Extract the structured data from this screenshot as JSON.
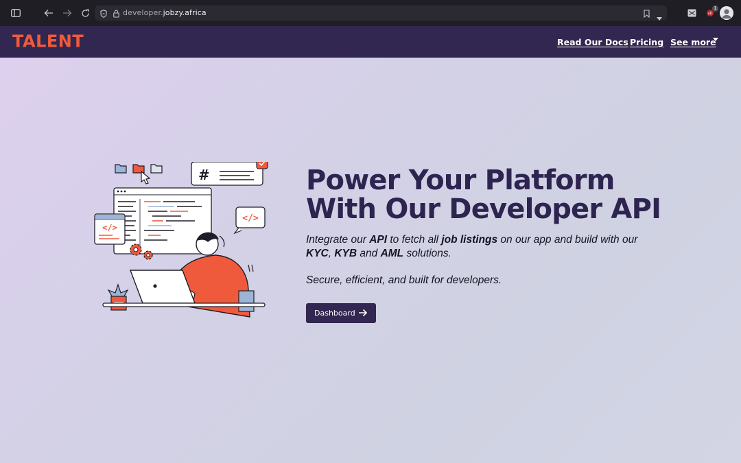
{
  "browser": {
    "url_domain_prefix": "developer.",
    "url_domain_main": "jobzy.africa",
    "badge_count": "1"
  },
  "nav": {
    "logo": "TALENT",
    "links": [
      "Read Our Docs",
      "Pricing",
      "See more"
    ]
  },
  "hero": {
    "title_line1": "Power Your Platform",
    "title_line2": "With Our Developer API",
    "desc_parts": [
      "Integrate our ",
      "API",
      " to fetch all ",
      "job listings",
      " on our app and build with our ",
      "KYC",
      ", ",
      "KYB",
      " and ",
      "AML",
      " solutions."
    ],
    "tagline": "Secure, efficient, and built for developers.",
    "button_label": "Dashboard"
  },
  "colors": {
    "nav_bg": "#322750",
    "logo": "#f05a3c",
    "title": "#2e2450",
    "accent_orange": "#f05a3c"
  },
  "icons": [
    "sidebar-icon",
    "back-icon",
    "forward-icon",
    "reload-icon",
    "shield-icon",
    "lock-icon",
    "bookmark-icon",
    "chevron-down-icon",
    "extension-icon",
    "profile-icon",
    "arrow-right-icon"
  ]
}
